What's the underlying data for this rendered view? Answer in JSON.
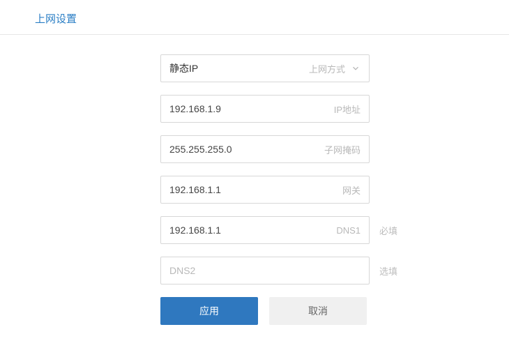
{
  "title": "上网设置",
  "connection_mode": {
    "selected": "静态IP",
    "label": "上网方式"
  },
  "fields": {
    "ip": {
      "value": "192.168.1.9",
      "label": "IP地址"
    },
    "subnet": {
      "value": "255.255.255.0",
      "label": "子网掩码"
    },
    "gateway": {
      "value": "192.168.1.1",
      "label": "网关"
    },
    "dns1": {
      "value": "192.168.1.1",
      "label": "DNS1",
      "note": "必填"
    },
    "dns2": {
      "value": "",
      "placeholder": "DNS2",
      "note": "选填"
    }
  },
  "buttons": {
    "apply": "应用",
    "cancel": "取消"
  }
}
